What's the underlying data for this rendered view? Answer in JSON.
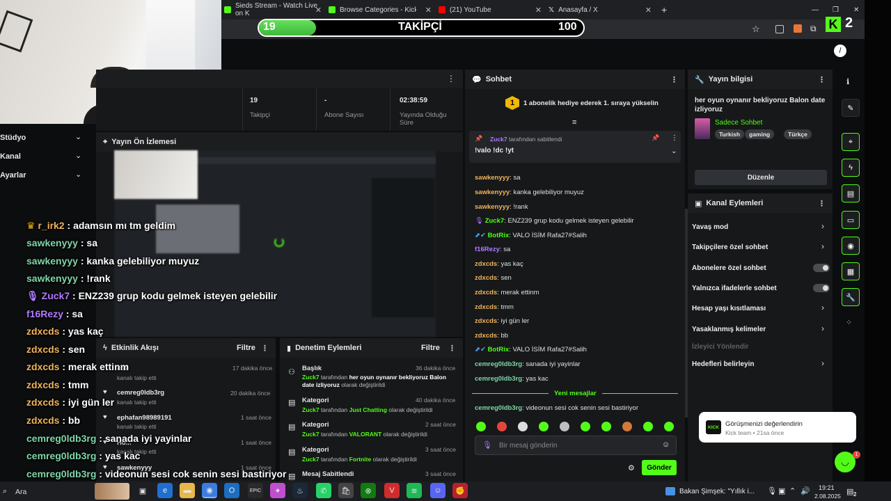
{
  "browser": {
    "tabs": [
      {
        "label": "Sieds Stream - Watch Live on K",
        "color": "#53fc18"
      },
      {
        "label": "Browse Categories - Kick Stream",
        "color": "#53fc18"
      },
      {
        "label": "(21) YouTube",
        "color": "#ff0000"
      },
      {
        "label": "Anasayfa / X",
        "color": "#ffffff"
      }
    ],
    "new_tab": "+"
  },
  "follow_goal": {
    "current": "19",
    "label": "TAKİPÇİ",
    "target": "100",
    "progress": 0.19
  },
  "overlay": {
    "logo_letter": "K",
    "logo_number": "2"
  },
  "dashboard": {
    "stats": [
      {
        "value": "19",
        "label": "Takipçi"
      },
      {
        "value": "-",
        "label": "Abone Sayısı"
      },
      {
        "value": "02:38:59",
        "label": "Yayında Olduğu Süre"
      }
    ],
    "side_menu": [
      "Stüdyo",
      "Kanal",
      "Ayarlar"
    ],
    "preview_title": "Yayın Ön İzlemesi"
  },
  "activity": {
    "title": "Etkinlik Akışı",
    "filter": "Filtre",
    "items": [
      {
        "user": "cds",
        "action": "kanalı takip etti",
        "time": "17 dakika önce"
      },
      {
        "user": "cemreg0ldb3rg",
        "action": "kanalı takip etti",
        "time": "20 dakika önce"
      },
      {
        "user": "ephafan98989191",
        "action": "kanalı takip etti",
        "time": "1 saat önce"
      },
      {
        "user": "Ho...",
        "action": "kanalı takip etti",
        "time": "1 saat önce"
      },
      {
        "user": "sawkenyyy",
        "action": "",
        "time": "1 saat önce"
      }
    ]
  },
  "moderation": {
    "title": "Denetim Eylemleri",
    "filter": "Filtre",
    "items": [
      {
        "title": "Başlık",
        "time": "36 dakika önce",
        "who": "Zuck7",
        "mid": " tarafından ",
        "what": "her oyun oynanır bekliyoruz Balon date izliyoruz",
        "end": " olarak değiştirildi"
      },
      {
        "title": "Kategori",
        "time": "40 dakika önce",
        "who": "Zuck7",
        "mid": " tarafından ",
        "what": "Just Chatting",
        "end": " olarak değiştirildi"
      },
      {
        "title": "Kategori",
        "time": "2 saat önce",
        "who": "Zuck7",
        "mid": " tarafından ",
        "what": "VALORANT",
        "end": " olarak değiştirildi"
      },
      {
        "title": "Kategori",
        "time": "3 saat önce",
        "who": "Zuck7",
        "mid": " tarafından ",
        "what": "Fortnite",
        "end": " olarak değiştirildi"
      },
      {
        "title": "Mesaj Sabitlendi",
        "time": "3 saat önce",
        "who": "",
        "mid": "",
        "what": "",
        "end": ""
      }
    ]
  },
  "chat": {
    "title": "Sohbet",
    "gift_banner": "1 abonelik hediye ederek 1. sıraya yükselin",
    "gift_rank": "1",
    "pinned_by": "Zuck7",
    "pinned_by_suffix": "tarafından sabitlendi",
    "pinned_message": "!valo !dc !yt",
    "messages": [
      {
        "user": "sawkenyyy",
        "color": "#f0b35a",
        "text": "sa"
      },
      {
        "user": "sawkenyyy",
        "color": "#f0b35a",
        "text": "kanka gelebiliyor muyuz"
      },
      {
        "user": "sawkenyyy",
        "color": "#f0b35a",
        "text": "!rank"
      },
      {
        "user": "Zuck7",
        "color": "#53fc18",
        "text": "ENZ239 grup kodu gelmek isteyen gelebilir"
      },
      {
        "user": "BotRix",
        "color": "#53fc18",
        "text": "VALO İSİM Rafa27#Salih"
      },
      {
        "user": "f16Rezy",
        "color": "#b07cff",
        "text": "sa"
      },
      {
        "user": "zdxcds",
        "color": "#f0b35a",
        "text": "yas kaç"
      },
      {
        "user": "zdxcds",
        "color": "#f0b35a",
        "text": "sen"
      },
      {
        "user": "zdxcds",
        "color": "#f0b35a",
        "text": "merak ettinm"
      },
      {
        "user": "zdxcds",
        "color": "#f0b35a",
        "text": "tmm"
      },
      {
        "user": "zdxcds",
        "color": "#f0b35a",
        "text": "iyi gün ler"
      },
      {
        "user": "zdxcds",
        "color": "#f0b35a",
        "text": "bb"
      },
      {
        "user": "BotRix",
        "color": "#53fc18",
        "text": "VALO İSİM Rafa27#Salih"
      },
      {
        "user": "cemreg0ldb3rg",
        "color": "#7fd6a8",
        "text": "sanada iyi yayinlar"
      },
      {
        "user": "cemreg0ldb3rg",
        "color": "#7fd6a8",
        "text": "yas kac"
      }
    ],
    "new_messages_label": "Yeni mesajlar",
    "last_message": {
      "user": "cemreg0ldb3rg",
      "color": "#7fd6a8",
      "text": "videonun sesi cok senin sesi bastiriyor"
    },
    "input_placeholder": "Bir mesaj gönderin",
    "send_label": "Gönder"
  },
  "stream_info": {
    "title": "Yayın bilgisi",
    "stream_title": "her oyun oynanır bekliyoruz Balon date izliyoruz",
    "category": "Sadece Sohbet",
    "tags": [
      "Turkish",
      "gaming",
      "Türkçe"
    ],
    "edit_label": "Düzenle"
  },
  "channel_actions": {
    "title": "Kanal Eylemleri",
    "items": [
      {
        "label": "Yavaş mod",
        "control": "chevron"
      },
      {
        "label": "Takipçilere özel sohbet",
        "control": "chevron"
      },
      {
        "label": "Abonelere özel sohbet",
        "control": "toggle"
      },
      {
        "label": "Yalnızca ifadelerle sohbet",
        "control": "toggle"
      },
      {
        "label": "Hesap yaşı kısıtlaması",
        "control": "chevron"
      },
      {
        "label": "Yasaklanmış kelimeler",
        "control": "chevron"
      },
      {
        "label": "İzleyici Yönlendir",
        "control": "none"
      },
      {
        "label": "Hedefleri belirleyin",
        "control": "chevron"
      }
    ]
  },
  "overlay_chat": [
    {
      "user": "r_irk2",
      "color": "#f0b35a",
      "text": "adamsın mı tm geldim"
    },
    {
      "user": "sawkenyyy",
      "color": "#7fd6a8",
      "text": "sa"
    },
    {
      "user": "sawkenyyy",
      "color": "#7fd6a8",
      "text": "kanka gelebiliyor muyuz"
    },
    {
      "user": "sawkenyyy",
      "color": "#7fd6a8",
      "text": "!rank"
    },
    {
      "user": "Zuck7",
      "color": "#b07cff",
      "text": "ENZ239 grup kodu gelmek isteyen gelebilir"
    },
    {
      "user": "f16Rezy",
      "color": "#b07cff",
      "text": "sa"
    },
    {
      "user": "zdxcds",
      "color": "#f0b35a",
      "text": "yas kaç"
    },
    {
      "user": "zdxcds",
      "color": "#f0b35a",
      "text": "sen"
    },
    {
      "user": "zdxcds",
      "color": "#f0b35a",
      "text": "merak ettinm"
    },
    {
      "user": "zdxcds",
      "color": "#f0b35a",
      "text": "tmm"
    },
    {
      "user": "zdxcds",
      "color": "#f0b35a",
      "text": "iyi gün ler"
    },
    {
      "user": "zdxcds",
      "color": "#f0b35a",
      "text": "bb"
    },
    {
      "user": "cemreg0ldb3rg",
      "color": "#7fd6a8",
      "text": "sanada iyi yayinlar"
    },
    {
      "user": "cemreg0ldb3rg",
      "color": "#7fd6a8",
      "text": "yas kac"
    },
    {
      "user": "cemreg0ldb3rg",
      "color": "#7fd6a8",
      "text": "videonun sesi cok senin sesi bastiriyor"
    }
  ],
  "toast": {
    "title": "Görüşmenizi değerlendirin",
    "subtitle": "Kick team • 21sa önce",
    "logo": "KICK",
    "badge": "1"
  },
  "taskbar": {
    "search": "Ara",
    "news": "Bakan Şimşek: \"Yıllık i...",
    "time": "19:21",
    "date": "2.08.2025",
    "notif": "2"
  }
}
